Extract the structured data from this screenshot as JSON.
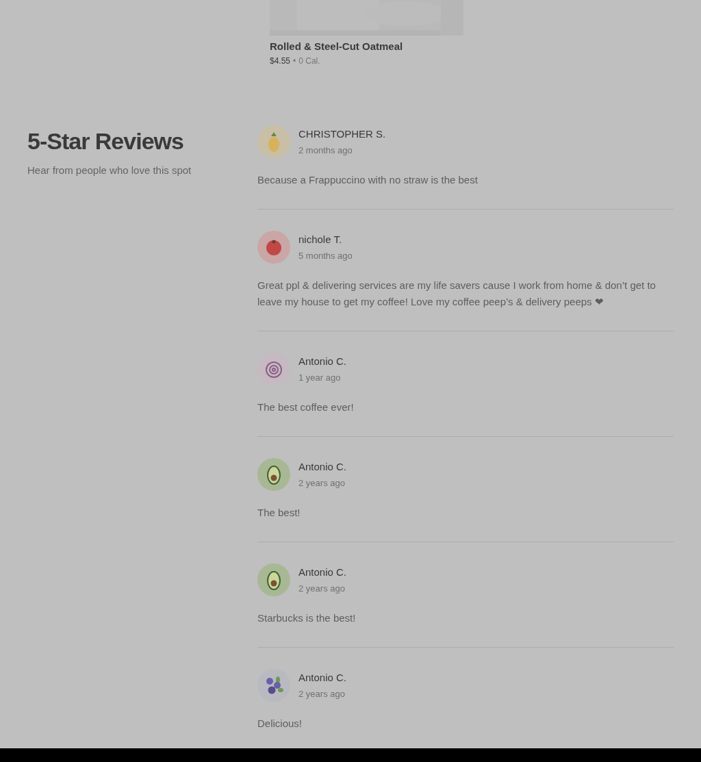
{
  "product": {
    "kind": "picture",
    "title": "Rolled & Steel-Cut Oatmeal",
    "price": "$4.55",
    "separator": "•",
    "calories": "0 Cal."
  },
  "reviews_section": {
    "title": "5-Star Reviews",
    "subtitle": "Hear from people who love this spot",
    "reviews": [
      {
        "name": "CHRISTOPHER S.",
        "time": "2 months ago",
        "text": "Because a Frappuccino with no straw is the best",
        "avatar": {
          "kind": "pineapple"
        }
      },
      {
        "name": "nichole T.",
        "time": "5 months ago",
        "text": "Great ppl & delivering services are my life savers cause I work from home & don’t get to leave my house to get my coffee! Love my coffee peep’s & delivery peeps ❤",
        "avatar": {
          "kind": "tomato"
        }
      },
      {
        "name": "Antonio C.",
        "time": "1 year ago",
        "text": "The best coffee ever!",
        "avatar": {
          "kind": "onion"
        }
      },
      {
        "name": "Antonio C.",
        "time": "2 years ago",
        "text": "The best!",
        "avatar": {
          "kind": "avocado"
        }
      },
      {
        "name": "Antonio C.",
        "time": "2 years ago",
        "text": "Starbucks is the best!",
        "avatar": {
          "kind": "avocado"
        }
      },
      {
        "name": "Antonio C.",
        "time": "2 years ago",
        "text": "Delicious!",
        "avatar": {
          "kind": "blueberry"
        }
      }
    ]
  }
}
